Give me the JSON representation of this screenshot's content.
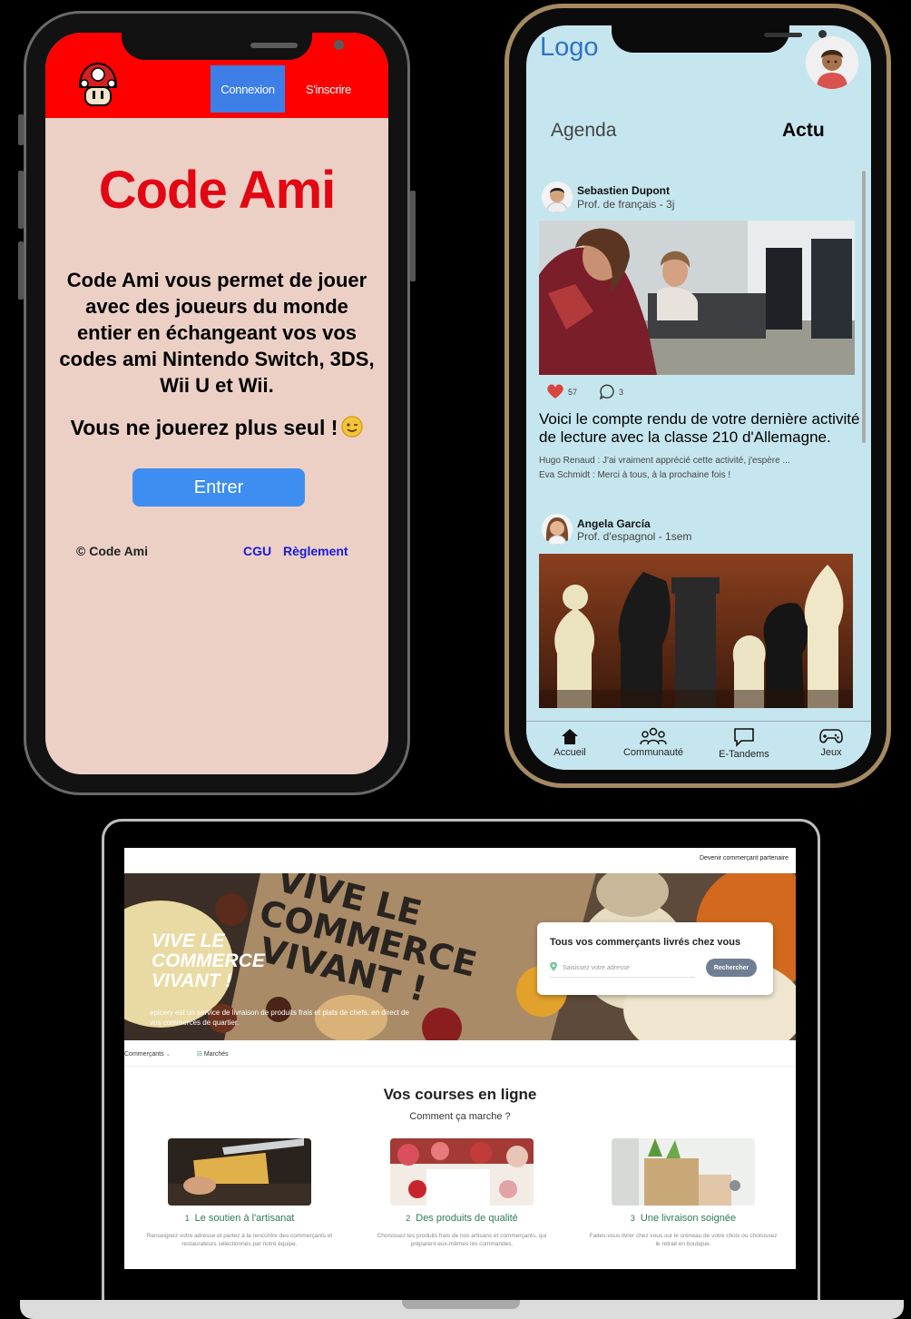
{
  "phone1": {
    "connexion": "Connexion",
    "inscrire": "S'inscrire",
    "title": "Code Ami",
    "description": "Code Ami vous permet de jouer avec des joueurs du monde entier en échangeant vos vos codes ami Nintendo Switch, 3DS, Wii U et Wii.",
    "tagline": "Vous ne jouerez plus seul !",
    "enter": "Entrer",
    "copyright": "© Code Ami",
    "cgu": "CGU",
    "reglement": "Règlement"
  },
  "phone2": {
    "logo": "Logo",
    "tabs": {
      "agenda": "Agenda",
      "actu": "Actu"
    },
    "posts": [
      {
        "author": "Sebastien Dupont",
        "role": "Prof. de français - 3j",
        "likes": "57",
        "comments_count": "3",
        "text": "Voici le compte rendu de votre dernière activité de lecture avec la classe 210 d'Allemagne.",
        "comments": [
          "Hugo Renaud : J'ai vraiment apprécié cette activité, j'espère ...",
          "Eva Schmidt : Merci à tous, à la prochaine fois !"
        ]
      },
      {
        "author": "Angela García",
        "role": "Prof. d'espagnol - 1sem"
      }
    ],
    "nav": [
      "Accueil",
      "Communauté",
      "E-Tandems",
      "Jeux"
    ]
  },
  "laptop": {
    "partner_link": "Devenir commerçant partenaire",
    "hero_title": "VIVE LE COMMERCE VIVANT !",
    "hero_subtitle": "epicery est un service de livraison de produits frais et plats de chefs, en direct de vos commerces de quartier.",
    "search": {
      "title": "Tous vos commerçants livrés chez vous",
      "placeholder": "Saisissez votre adresse",
      "button": "Rechercher"
    },
    "nav": {
      "commercants": "Commerçants",
      "marches": "Marchés"
    },
    "heading": "Vos courses en ligne",
    "subheading": "Comment ça marche ?",
    "steps": [
      {
        "num": "1",
        "title": "Le soutien à l'artisanat",
        "desc": "Renseignez votre adresse et partez à la rencontre des commerçants et restaurateurs sélectionnés par notre équipe."
      },
      {
        "num": "2",
        "title": "Des produits de qualité",
        "desc": "Choisissez les produits frais de nos artisans et commerçants, qui préparent eux-mêmes les commandes."
      },
      {
        "num": "3",
        "title": "Une livraison soignée",
        "desc": "Faites-vous livrer chez vous sur le créneau de votre choix ou choisissez le retrait en boutique."
      }
    ]
  },
  "colors": {
    "codeami_red": "#e30613",
    "codeami_header": "#ff0000",
    "codeami_bg": "#ecd0c6",
    "button_blue": "#3d7fe6",
    "app_bg": "#c6e6ef",
    "logo_blue": "#2d74c4",
    "epicery_green": "#2b7c53"
  }
}
